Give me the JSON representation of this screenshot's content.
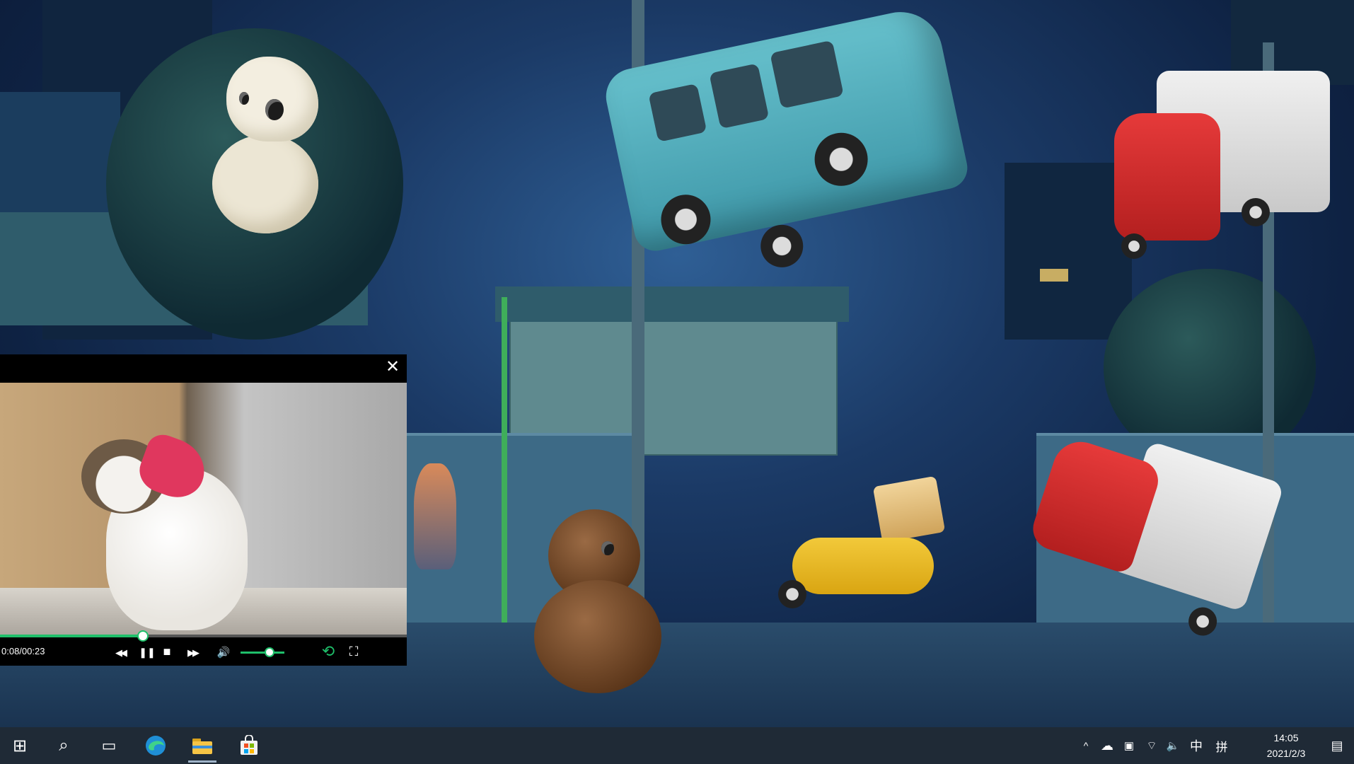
{
  "player": {
    "close_glyph": "✕",
    "time": "0:08/00:23",
    "progress": 0.35,
    "volume": 0.65,
    "controls": {
      "rewind": "◀◀",
      "pause": "❚❚",
      "stop": "■",
      "forward": "▶▶",
      "volume": "🔊",
      "loop": "⟲",
      "fullscreen": "⛶"
    }
  },
  "taskbar": {
    "start": "⊞",
    "search": "⌕",
    "task_view": "▭",
    "tray": {
      "chevron": "^",
      "onedrive": "☁",
      "battery": "▣",
      "wifi": "⌔",
      "volume": "🔈",
      "ime_language": "中",
      "ime_mode": "拼"
    },
    "clock": {
      "time": "14:05",
      "date": "2021/2/3"
    },
    "notifications": "▤"
  },
  "colors": {
    "accent_green": "#1fbf6a",
    "taskbar": "#1f2a36"
  }
}
